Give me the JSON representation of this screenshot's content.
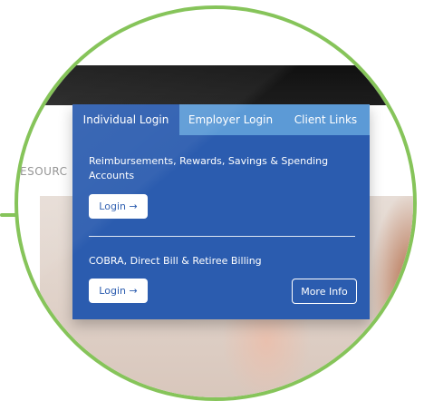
{
  "background": {
    "nav_fragment": "ESOURC"
  },
  "login_panel": {
    "tabs": [
      {
        "label": "Individual Login",
        "active": true
      },
      {
        "label": "Employer Login",
        "active": false
      },
      {
        "label": "Client Links",
        "active": false
      }
    ],
    "section_1": {
      "title": "Reimbursements, Rewards, Savings & Spending Accounts",
      "button_label": "Login →"
    },
    "section_2": {
      "title": "COBRA, Direct Bill & Retiree Billing",
      "button_label": "Login →",
      "more_label": "More Info"
    }
  },
  "colors": {
    "panel_blue": "#2b5caf",
    "tab_inactive": "#5c9ad6",
    "ring_green": "#86c45a"
  }
}
